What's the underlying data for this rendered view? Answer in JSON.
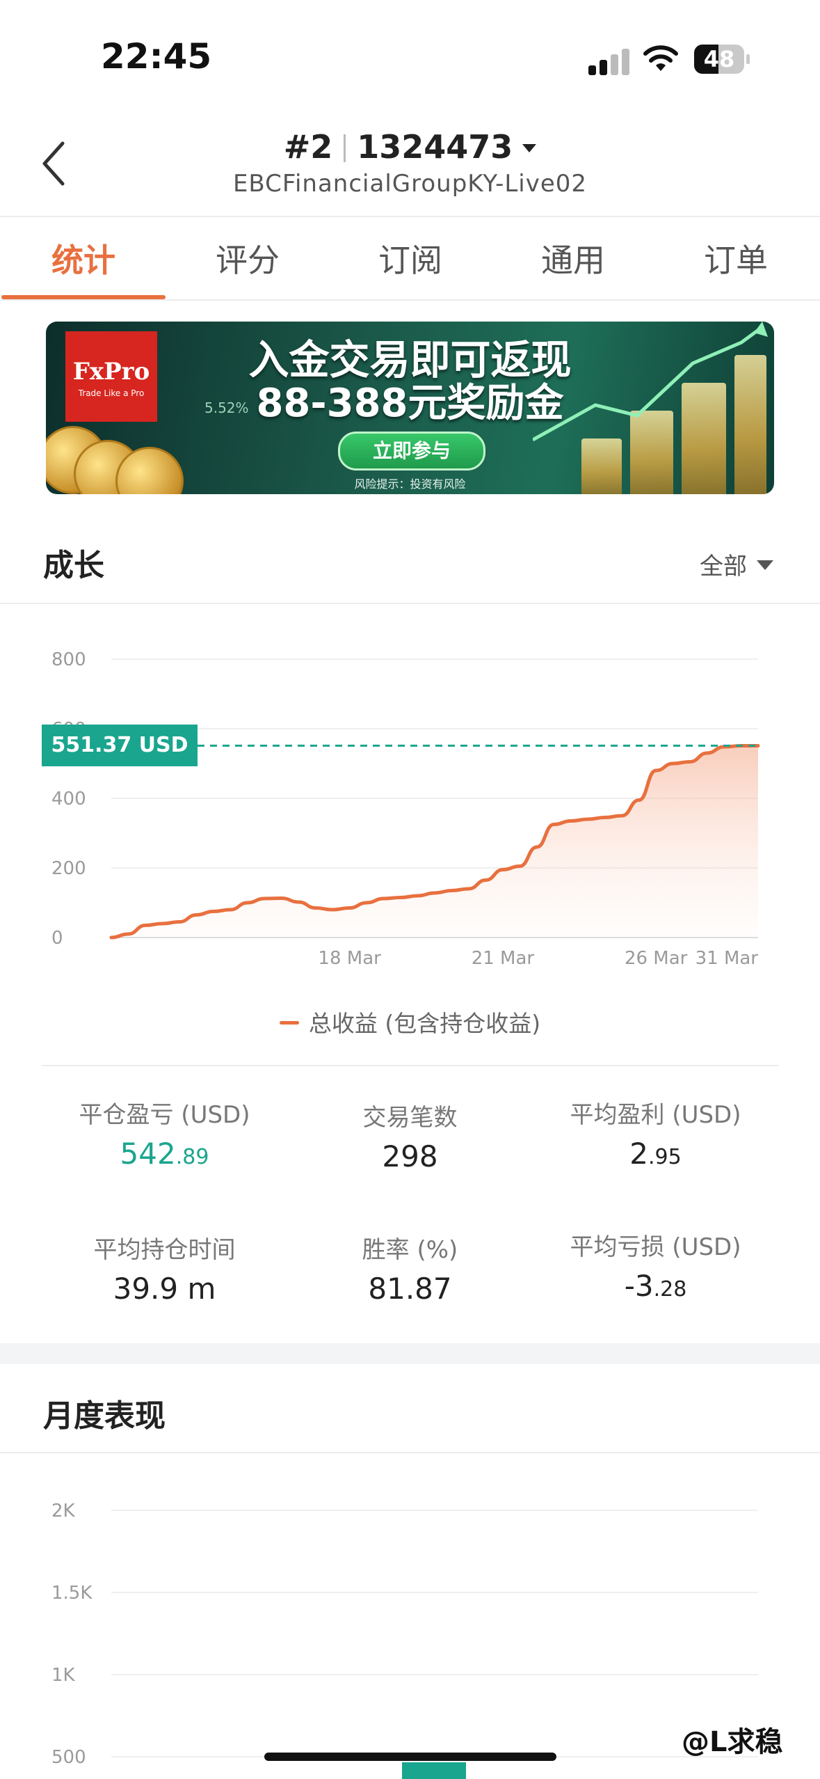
{
  "status_bar": {
    "time": "22:45",
    "battery": "48",
    "battery_level": 0.48
  },
  "header": {
    "account_index": "#2",
    "account_number": "1324473",
    "server": "EBCFinancialGroupKY-Live02"
  },
  "tabs": [
    {
      "label": "统计",
      "active": true
    },
    {
      "label": "评分",
      "active": false
    },
    {
      "label": "订阅",
      "active": false
    },
    {
      "label": "通用",
      "active": false
    },
    {
      "label": "订单",
      "active": false
    }
  ],
  "banner": {
    "brand": "FxPro",
    "tagline": "Trade Like a Pro",
    "percent_text": "5.52%",
    "headline": "入金交易即可返现",
    "subheadline": "88-388元奖励金",
    "cta": "立即参与",
    "risk_note": "风险提示：投资有风险"
  },
  "growth": {
    "title": "成长",
    "range": "全部",
    "current_value_label": "551.37 USD",
    "legend": "总收益 (包含持仓收益)"
  },
  "chart_data": {
    "type": "area",
    "y_ticks": [
      "800",
      "600",
      "400",
      "200",
      "0"
    ],
    "ylim": [
      0,
      800
    ],
    "x_ticks": [
      "18 Mar",
      "21 Mar",
      "26 Mar",
      "31 Mar"
    ],
    "series": [
      {
        "name": "总收益 (包含持仓收益)",
        "color": "#e8703f",
        "x_index": [
          0,
          0.5,
          1,
          1.5,
          2,
          2.5,
          3,
          3.5,
          4,
          4.5,
          5,
          5.5,
          6,
          6.5,
          7,
          7.5,
          8,
          8.5,
          9,
          9.5,
          10,
          10.5,
          11,
          11.5,
          12,
          12.5,
          13,
          13.5,
          14,
          14.5,
          15,
          15.5,
          16,
          16.5,
          17,
          17.5,
          18,
          18.5,
          19
        ],
        "values": [
          0,
          10,
          35,
          40,
          45,
          65,
          75,
          80,
          100,
          112,
          113,
          102,
          85,
          80,
          85,
          100,
          112,
          115,
          120,
          128,
          135,
          140,
          165,
          195,
          205,
          260,
          325,
          335,
          340,
          345,
          350,
          395,
          480,
          500,
          505,
          530,
          548,
          551,
          551
        ]
      }
    ],
    "marker_value": 551.37
  },
  "stats": [
    {
      "label": "平仓盈亏 (USD)",
      "int": "542",
      "dec": ".89",
      "positive": true
    },
    {
      "label": "交易笔数",
      "int": "298",
      "dec": "",
      "positive": false
    },
    {
      "label": "平均盈利 (USD)",
      "int": "2",
      "dec": ".95",
      "positive": false
    },
    {
      "label": "平均持仓时间",
      "int": "39.9 m",
      "dec": "",
      "positive": false
    },
    {
      "label": "胜率 (%)",
      "int": "81.87",
      "dec": "",
      "positive": false
    },
    {
      "label": "平均亏损 (USD)",
      "int": "-3",
      "dec": ".28",
      "positive": false
    }
  ],
  "monthly": {
    "title": "月度表现",
    "y_ticks": [
      "2K",
      "1.5K",
      "1K",
      "500"
    ]
  },
  "watermark": "@L求稳"
}
